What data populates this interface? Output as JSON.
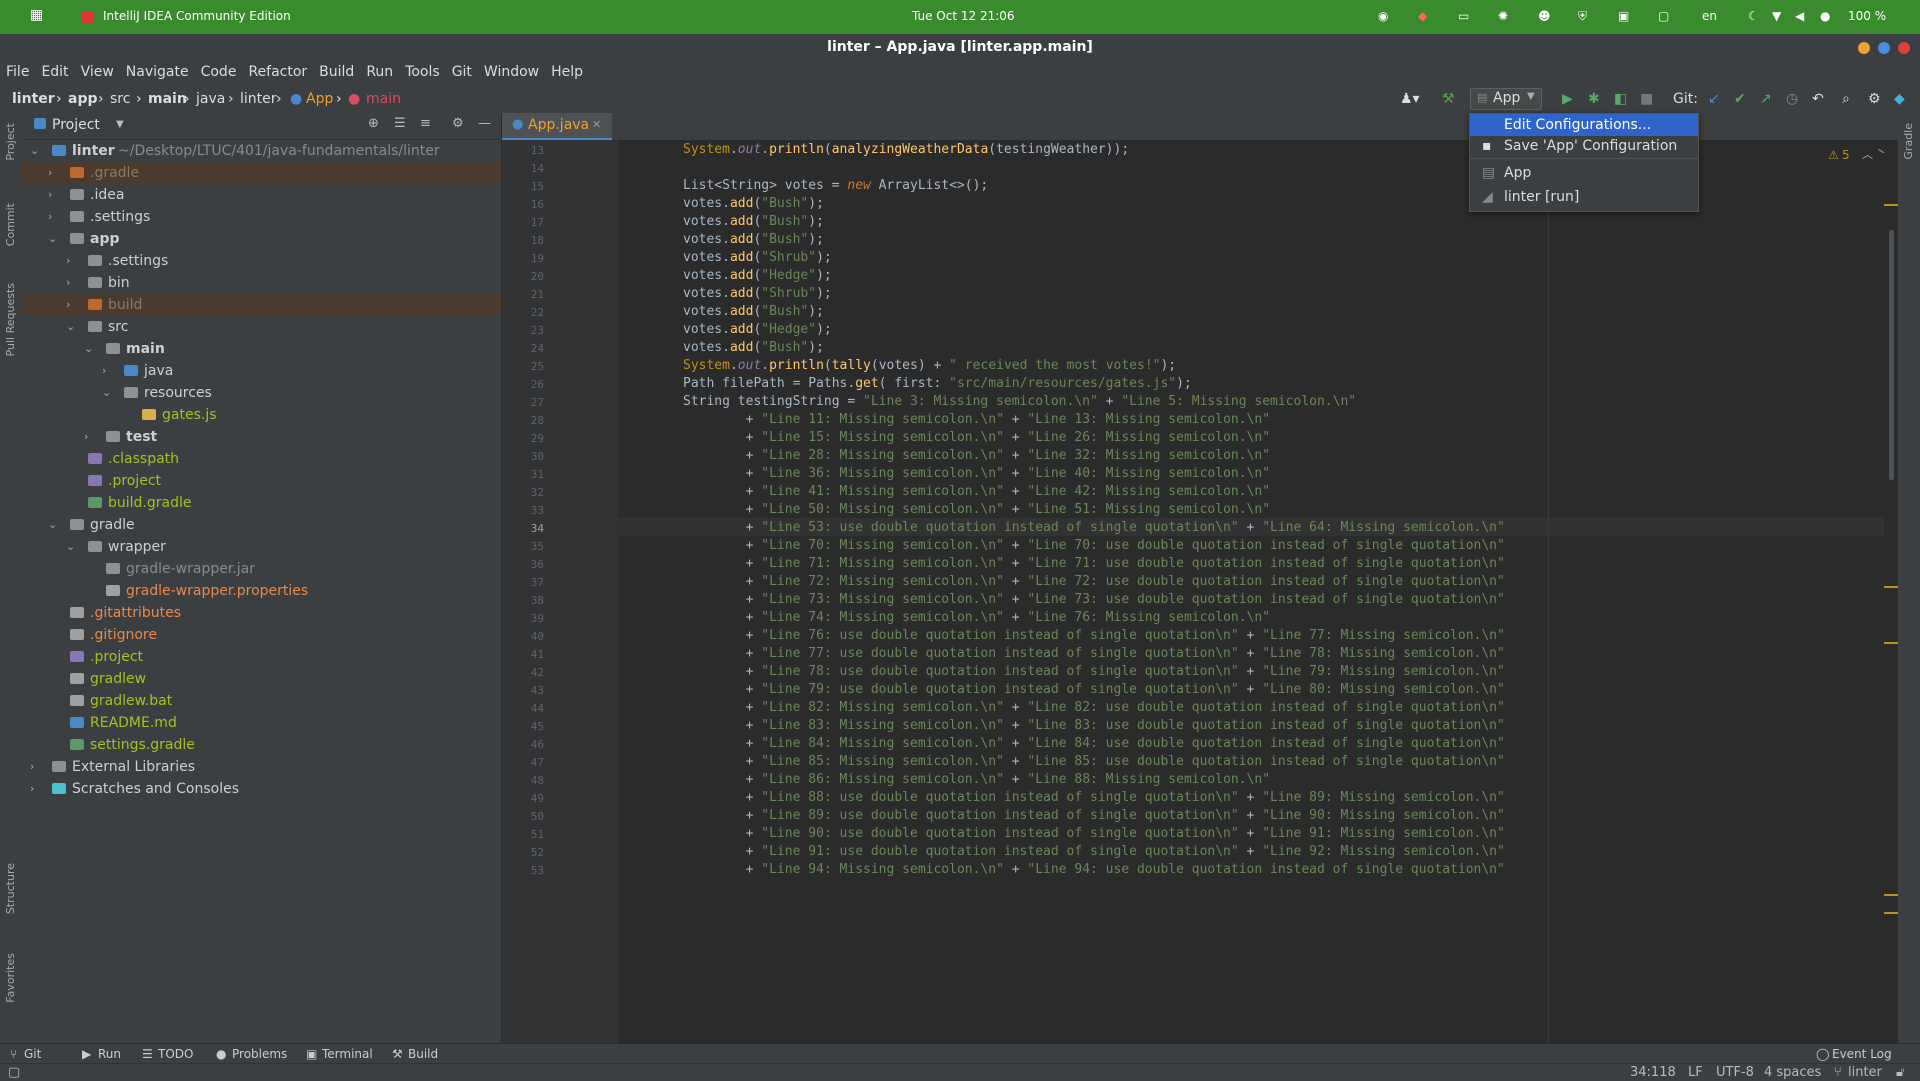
{
  "system": {
    "app_name": "IntelliJ IDEA Community Edition",
    "datetime": "Tue Oct 12  21:06",
    "lang": "en",
    "battery": "100 %"
  },
  "window": {
    "title": "linter – App.java [linter.app.main]"
  },
  "menu": [
    "File",
    "Edit",
    "View",
    "Navigate",
    "Code",
    "Refactor",
    "Build",
    "Run",
    "Tools",
    "Git",
    "Window",
    "Help"
  ],
  "breadcrumb": [
    "linter",
    "app",
    "src",
    "main",
    "java",
    "linter",
    "App",
    "main"
  ],
  "toolbar": {
    "run_config": "App",
    "git_label": "Git:"
  },
  "run_menu": {
    "items": [
      "Edit Configurations...",
      "Save 'App' Configuration",
      "App",
      "linter [run]"
    ]
  },
  "left_strip": [
    "Project",
    "Commit",
    "Pull Requests",
    "Structure",
    "Favorites"
  ],
  "right_strip": [
    "Gradle"
  ],
  "project": {
    "header": "Project",
    "tree": [
      {
        "label": "linter",
        "path": "~/Desktop/LTUC/401/java-fundamentals/linter",
        "depth": 0,
        "expanded": true,
        "kind": "module",
        "bold": true
      },
      {
        "label": ".gradle",
        "depth": 1,
        "expanded": false,
        "kind": "folder-excluded",
        "sel": true
      },
      {
        "label": ".idea",
        "depth": 1,
        "expanded": false,
        "kind": "folder"
      },
      {
        "label": ".settings",
        "depth": 1,
        "expanded": false,
        "kind": "folder"
      },
      {
        "label": "app",
        "depth": 1,
        "expanded": true,
        "kind": "folder",
        "bold": true
      },
      {
        "label": ".settings",
        "depth": 2,
        "expanded": false,
        "kind": "folder"
      },
      {
        "label": "bin",
        "depth": 2,
        "expanded": false,
        "kind": "folder"
      },
      {
        "label": "build",
        "depth": 2,
        "expanded": false,
        "kind": "folder-excluded",
        "sel": true
      },
      {
        "label": "src",
        "depth": 2,
        "expanded": true,
        "kind": "folder"
      },
      {
        "label": "main",
        "depth": 3,
        "expanded": true,
        "kind": "folder",
        "bold": true
      },
      {
        "label": "java",
        "depth": 4,
        "expanded": false,
        "kind": "folder-src"
      },
      {
        "label": "resources",
        "depth": 4,
        "expanded": true,
        "kind": "folder"
      },
      {
        "label": "gates.js",
        "depth": 5,
        "kind": "file-js"
      },
      {
        "label": "test",
        "depth": 3,
        "expanded": false,
        "kind": "folder",
        "bold": true
      },
      {
        "label": ".classpath",
        "depth": 2,
        "kind": "file-eclipse"
      },
      {
        "label": ".project",
        "depth": 2,
        "kind": "file-eclipse"
      },
      {
        "label": "build.gradle",
        "depth": 2,
        "kind": "file-gradle"
      },
      {
        "label": "gradle",
        "depth": 1,
        "expanded": true,
        "kind": "folder"
      },
      {
        "label": "wrapper",
        "depth": 2,
        "expanded": true,
        "kind": "folder"
      },
      {
        "label": "gradle-wrapper.jar",
        "depth": 3,
        "kind": "file-jar"
      },
      {
        "label": "gradle-wrapper.properties",
        "depth": 3,
        "kind": "file-props"
      },
      {
        "label": ".gitattributes",
        "depth": 1,
        "kind": "file-git"
      },
      {
        "label": ".gitignore",
        "depth": 1,
        "kind": "file-git"
      },
      {
        "label": ".project",
        "depth": 1,
        "kind": "file-eclipse"
      },
      {
        "label": "gradlew",
        "depth": 1,
        "kind": "file-exec"
      },
      {
        "label": "gradlew.bat",
        "depth": 1,
        "kind": "file-exec"
      },
      {
        "label": "README.md",
        "depth": 1,
        "kind": "file-md"
      },
      {
        "label": "settings.gradle",
        "depth": 1,
        "kind": "file-gradle"
      },
      {
        "label": "External Libraries",
        "depth": 0,
        "expanded": false,
        "kind": "libs"
      },
      {
        "label": "Scratches and Consoles",
        "depth": 0,
        "expanded": false,
        "kind": "scratch"
      }
    ]
  },
  "editor": {
    "tab": "App.java",
    "problems": "5",
    "current_line": 34,
    "lines": [
      {
        "n": 13,
        "t": "System.out.println(analyzingWeatherData(testingWeather));"
      },
      {
        "n": 14,
        "t": ""
      },
      {
        "n": 15,
        "t": "List<String> votes = new ArrayList<>();"
      },
      {
        "n": 16,
        "t": "votes.add(\"Bush\");"
      },
      {
        "n": 17,
        "t": "votes.add(\"Bush\");"
      },
      {
        "n": 18,
        "t": "votes.add(\"Bush\");"
      },
      {
        "n": 19,
        "t": "votes.add(\"Shrub\");"
      },
      {
        "n": 20,
        "t": "votes.add(\"Hedge\");"
      },
      {
        "n": 21,
        "t": "votes.add(\"Shrub\");"
      },
      {
        "n": 22,
        "t": "votes.add(\"Bush\");"
      },
      {
        "n": 23,
        "t": "votes.add(\"Hedge\");"
      },
      {
        "n": 24,
        "t": "votes.add(\"Bush\");"
      },
      {
        "n": 25,
        "t": "System.out.println(tally(votes) + \" received the most votes!\");"
      },
      {
        "n": 26,
        "t": "Path filePath = Paths.get( first: \"src/main/resources/gates.js\");"
      },
      {
        "n": 27,
        "t": "String testingString = \"Line 3: Missing semicolon.\\n\" + \"Line 5: Missing semicolon.\\n\""
      },
      {
        "n": 28,
        "t": "        + \"Line 11: Missing semicolon.\\n\" + \"Line 13: Missing semicolon.\\n\""
      },
      {
        "n": 29,
        "t": "        + \"Line 15: Missing semicolon.\\n\" + \"Line 26: Missing semicolon.\\n\""
      },
      {
        "n": 30,
        "t": "        + \"Line 28: Missing semicolon.\\n\" + \"Line 32: Missing semicolon.\\n\""
      },
      {
        "n": 31,
        "t": "        + \"Line 36: Missing semicolon.\\n\" + \"Line 40: Missing semicolon.\\n\""
      },
      {
        "n": 32,
        "t": "        + \"Line 41: Missing semicolon.\\n\" + \"Line 42: Missing semicolon.\\n\""
      },
      {
        "n": 33,
        "t": "        + \"Line 50: Missing semicolon.\\n\" + \"Line 51: Missing semicolon.\\n\""
      },
      {
        "n": 34,
        "t": "        + \"Line 53: use double quotation instead of single quotation\\n\" + \"Line 64: Missing semicolon.\\n\""
      },
      {
        "n": 35,
        "t": "        + \"Line 70: Missing semicolon.\\n\" + \"Line 70: use double quotation instead of single quotation\\n\""
      },
      {
        "n": 36,
        "t": "        + \"Line 71: Missing semicolon.\\n\" + \"Line 71: use double quotation instead of single quotation\\n\""
      },
      {
        "n": 37,
        "t": "        + \"Line 72: Missing semicolon.\\n\" + \"Line 72: use double quotation instead of single quotation\\n\""
      },
      {
        "n": 38,
        "t": "        + \"Line 73: Missing semicolon.\\n\" + \"Line 73: use double quotation instead of single quotation\\n\""
      },
      {
        "n": 39,
        "t": "        + \"Line 74: Missing semicolon.\\n\" + \"Line 76: Missing semicolon.\\n\""
      },
      {
        "n": 40,
        "t": "        + \"Line 76: use double quotation instead of single quotation\\n\" + \"Line 77: Missing semicolon.\\n\""
      },
      {
        "n": 41,
        "t": "        + \"Line 77: use double quotation instead of single quotation\\n\" + \"Line 78: Missing semicolon.\\n\""
      },
      {
        "n": 42,
        "t": "        + \"Line 78: use double quotation instead of single quotation\\n\" + \"Line 79: Missing semicolon.\\n\""
      },
      {
        "n": 43,
        "t": "        + \"Line 79: use double quotation instead of single quotation\\n\" + \"Line 80: Missing semicolon.\\n\""
      },
      {
        "n": 44,
        "t": "        + \"Line 82: Missing semicolon.\\n\" + \"Line 82: use double quotation instead of single quotation\\n\""
      },
      {
        "n": 45,
        "t": "        + \"Line 83: Missing semicolon.\\n\" + \"Line 83: use double quotation instead of single quotation\\n\""
      },
      {
        "n": 46,
        "t": "        + \"Line 84: Missing semicolon.\\n\" + \"Line 84: use double quotation instead of single quotation\\n\""
      },
      {
        "n": 47,
        "t": "        + \"Line 85: Missing semicolon.\\n\" + \"Line 85: use double quotation instead of single quotation\\n\""
      },
      {
        "n": 48,
        "t": "        + \"Line 86: Missing semicolon.\\n\" + \"Line 88: Missing semicolon.\\n\""
      },
      {
        "n": 49,
        "t": "        + \"Line 88: use double quotation instead of single quotation\\n\" + \"Line 89: Missing semicolon.\\n\""
      },
      {
        "n": 50,
        "t": "        + \"Line 89: use double quotation instead of single quotation\\n\" + \"Line 90: Missing semicolon.\\n\""
      },
      {
        "n": 51,
        "t": "        + \"Line 90: use double quotation instead of single quotation\\n\" + \"Line 91: Missing semicolon.\\n\""
      },
      {
        "n": 52,
        "t": "        + \"Line 91: use double quotation instead of single quotation\\n\" + \"Line 92: Missing semicolon.\\n\""
      },
      {
        "n": 53,
        "t": "        + \"Line 94: Missing semicolon.\\n\" + \"Line 94: use double quotation instead of single quotation\\n\""
      }
    ]
  },
  "bottom_tools": [
    "Git",
    "Run",
    "TODO",
    "Problems",
    "Terminal",
    "Build"
  ],
  "event_log": "Event Log",
  "status": {
    "position": "34:118",
    "line_sep": "LF",
    "encoding": "UTF-8",
    "indent": "4 spaces",
    "branch": "linter"
  },
  "colors": {
    "accent": "#4a88c7",
    "selection": "#2f65ca",
    "system_bar": "#3a8a2e",
    "excluded": "#4b3b2e"
  }
}
